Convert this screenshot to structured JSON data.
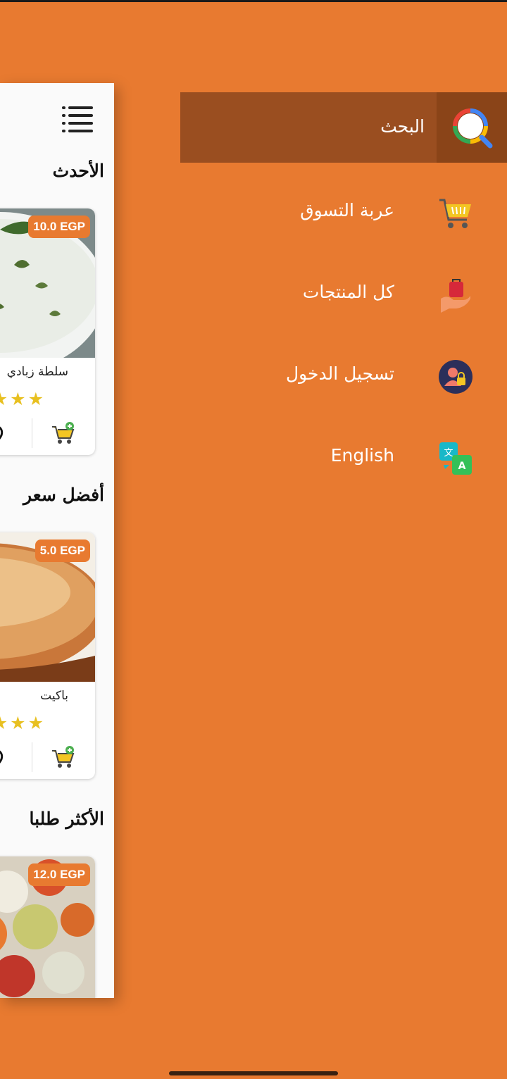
{
  "drawer": {
    "search_label": "البحث",
    "items": [
      {
        "label": "عربة التسوق",
        "icon": "shopping-cart-icon"
      },
      {
        "label": "كل المنتجات",
        "icon": "shopping-bag-hand-icon"
      },
      {
        "label": "تسجيل الدخول",
        "icon": "user-lock-icon"
      },
      {
        "label": "English",
        "icon": "translate-icon"
      }
    ]
  },
  "main": {
    "sections": [
      {
        "title": "الأحدث",
        "product": {
          "name": "سلطة زبادي",
          "price": "10.0 EGP"
        }
      },
      {
        "title": "أفضل سعر",
        "product": {
          "name": "باكيت",
          "price": "5.0 EGP"
        }
      },
      {
        "title": "الأكثر طلبا",
        "product": {
          "price": "12.0 EGP"
        }
      }
    ]
  },
  "colors": {
    "accent": "#E87A30",
    "search_bar": "#9A4E20",
    "star": "#E8C020"
  }
}
